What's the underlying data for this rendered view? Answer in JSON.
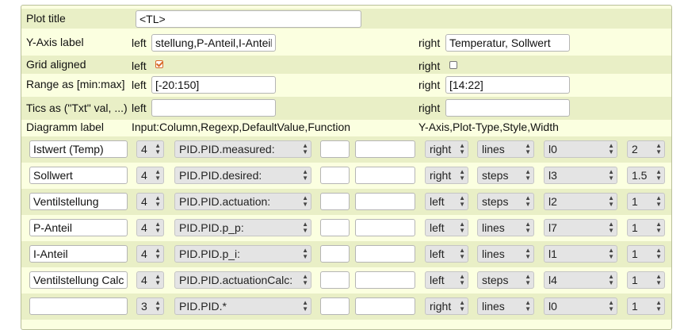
{
  "plot_title": {
    "label": "Plot title",
    "value": "<TL>"
  },
  "y_axis_label": {
    "label": "Y-Axis label",
    "left_tag": "left",
    "left_value": "stellung,P-Anteil,I-Anteil",
    "right_tag": "right",
    "right_value": "Temperatur, Sollwert"
  },
  "grid_aligned": {
    "label": "Grid aligned",
    "left_tag": "left",
    "left_checked": true,
    "right_tag": "right",
    "right_checked": false
  },
  "range": {
    "label": "Range as [min:max]",
    "left_tag": "left",
    "left_value": "[-20:150]",
    "right_tag": "right",
    "right_value": "[14:22]"
  },
  "tics": {
    "label": "Tics as (\"Txt\" val, ...)",
    "left_tag": "left",
    "left_value": "",
    "right_tag": "right",
    "right_value": ""
  },
  "header": {
    "diagram_label": "Diagramm label",
    "input_cols": "Input:Column,Regexp,DefaultValue,Function",
    "yaxis_cols": "Y-Axis,Plot-Type,Style,Width"
  },
  "series": [
    {
      "label": "Istwert (Temp)",
      "column": "4",
      "regexp": "PID.PID.measured:",
      "default": "",
      "function": "",
      "axis": "right",
      "type": "lines",
      "style": "l0",
      "width": "2"
    },
    {
      "label": "Sollwert",
      "column": "4",
      "regexp": "PID.PID.desired:",
      "default": "",
      "function": "",
      "axis": "right",
      "type": "steps",
      "style": "l3",
      "width": "1.5"
    },
    {
      "label": "Ventilstellung",
      "column": "4",
      "regexp": "PID.PID.actuation:",
      "default": "",
      "function": "",
      "axis": "left",
      "type": "steps",
      "style": "l2",
      "width": "1"
    },
    {
      "label": "P-Anteil",
      "column": "4",
      "regexp": "PID.PID.p_p:",
      "default": "",
      "function": "",
      "axis": "left",
      "type": "lines",
      "style": "l7",
      "width": "1"
    },
    {
      "label": "I-Anteil",
      "column": "4",
      "regexp": "PID.PID.p_i:",
      "default": "",
      "function": "",
      "axis": "left",
      "type": "lines",
      "style": "l1",
      "width": "1"
    },
    {
      "label": "Ventilstellung Calc",
      "column": "4",
      "regexp": "PID.PID.actuationCalc:",
      "default": "",
      "function": "",
      "axis": "left",
      "type": "steps",
      "style": "l4",
      "width": "1"
    },
    {
      "label": "",
      "column": "3",
      "regexp": "PID.PID.*",
      "default": "",
      "function": "",
      "axis": "right",
      "type": "lines",
      "style": "l0",
      "width": "1"
    }
  ]
}
